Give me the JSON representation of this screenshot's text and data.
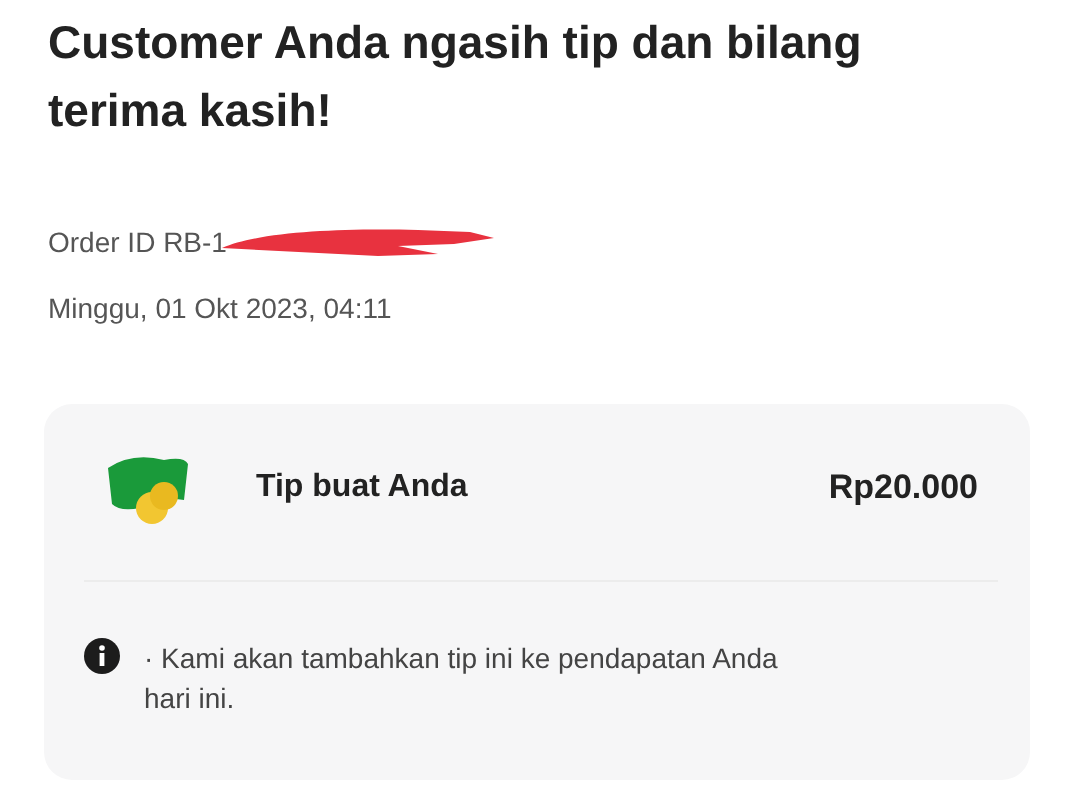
{
  "heading": "Customer Anda ngasih tip dan bilang terima kasih!",
  "order_id": "Order ID RB-1",
  "date": "Minggu, 01 Okt 2023, 04:11",
  "tip": {
    "label": "Tip buat Anda",
    "amount": "Rp20.000"
  },
  "note": "· Kami akan tambahkan tip ini ke pendapatan Anda hari ini."
}
